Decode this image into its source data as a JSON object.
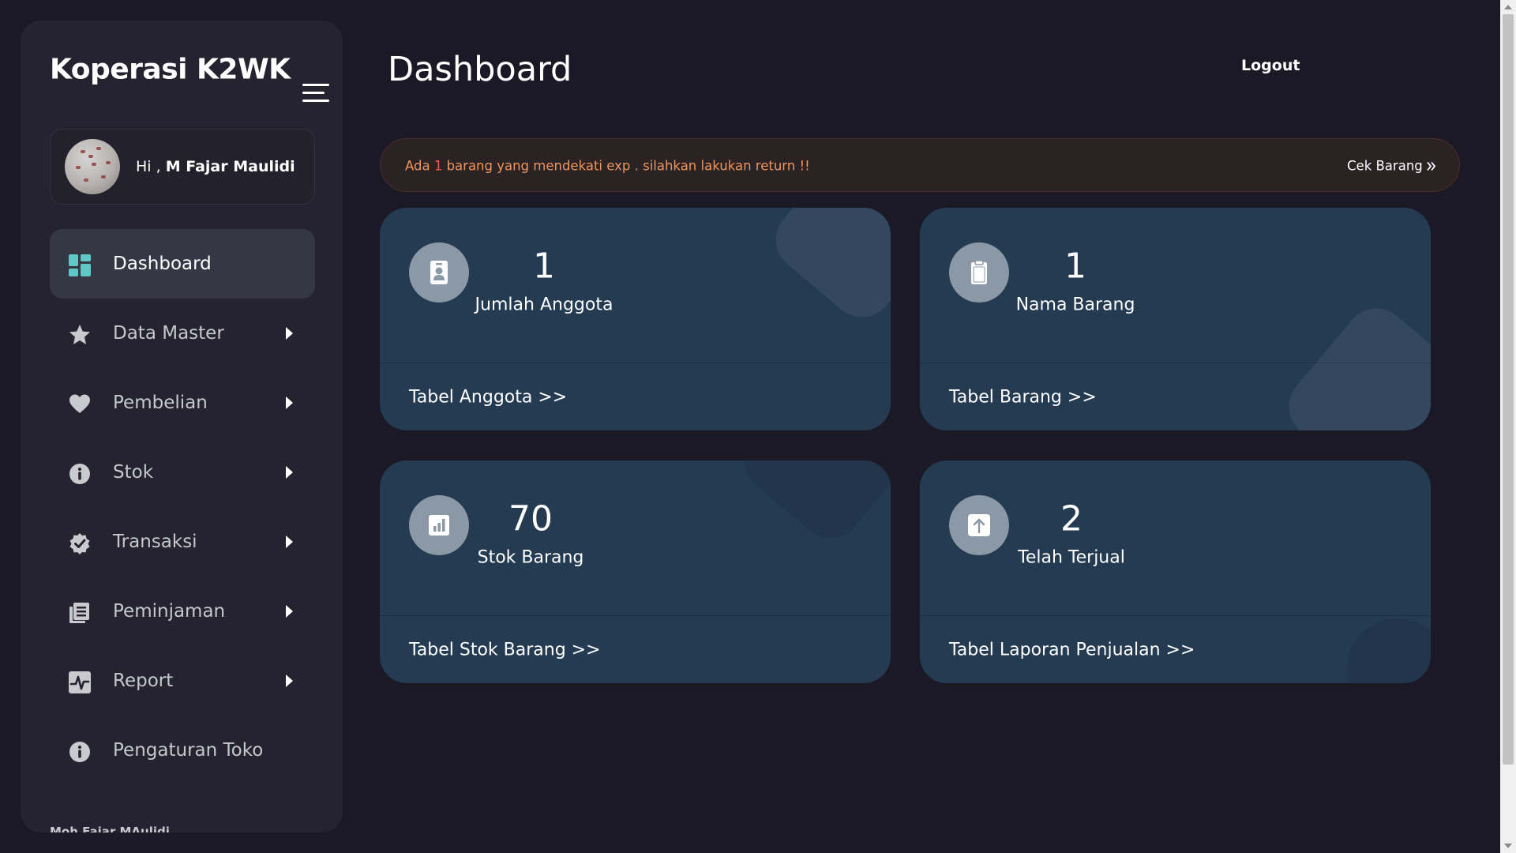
{
  "sidebar": {
    "brand": "Koperasi K2WK",
    "user": {
      "greeting_prefix": "Hi ,",
      "name": "M Fajar Maulidi"
    },
    "items": [
      {
        "label": "Dashboard",
        "icon": "dashboard-grid-icon",
        "active": true,
        "has_submenu": false
      },
      {
        "label": "Data Master",
        "icon": "star-icon",
        "active": false,
        "has_submenu": true
      },
      {
        "label": "Pembelian",
        "icon": "heart-icon",
        "active": false,
        "has_submenu": true
      },
      {
        "label": "Stok",
        "icon": "info-icon",
        "active": false,
        "has_submenu": true
      },
      {
        "label": "Transaksi",
        "icon": "badge-check-icon",
        "active": false,
        "has_submenu": true
      },
      {
        "label": "Peminjaman",
        "icon": "book-icon",
        "active": false,
        "has_submenu": true
      },
      {
        "label": "Report",
        "icon": "activity-icon",
        "active": false,
        "has_submenu": true
      },
      {
        "label": "Pengaturan Toko",
        "icon": "info-icon",
        "active": false,
        "has_submenu": false
      }
    ],
    "footer": "Moh Fajar MAulidi"
  },
  "header": {
    "title": "Dashboard",
    "logout_label": "Logout"
  },
  "alert": {
    "text_before": "Ada ",
    "count": "1",
    "text_after": " barang yang mendekati exp . silahkan lakukan return !!",
    "link_label": "Cek Barang",
    "link_icon": "double-chevron-right-icon",
    "text_color": "#f0945c",
    "count_color": "#f05b4a"
  },
  "cards": [
    {
      "count": "1",
      "label": "Jumlah Anggota",
      "link": "Tabel Anggota >>",
      "icon": "id-badge-icon"
    },
    {
      "count": "1",
      "label": "Nama Barang",
      "link": "Tabel Barang >>",
      "icon": "clipboard-icon"
    },
    {
      "count": "70",
      "label": "Stok Barang",
      "link": "Tabel Stok Barang >>",
      "icon": "bar-chart-icon"
    },
    {
      "count": "2",
      "label": "Telah Terjual",
      "link": "Tabel Laporan Penjualan >>",
      "icon": "arrow-up-icon"
    }
  ],
  "colors": {
    "background": "#1b1925",
    "sidebar": "#24232f",
    "card": "#243b52",
    "icon_circle": "#8b99a6"
  }
}
